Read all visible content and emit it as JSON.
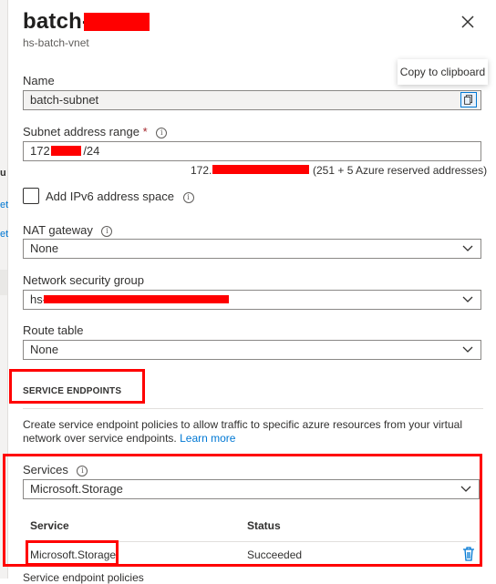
{
  "left_nav": {
    "fragments": [
      "u",
      "et",
      "et"
    ]
  },
  "panel": {
    "title_prefix": "batch-",
    "subtitle": "hs-batch-vnet",
    "copy_tooltip": "Copy to clipboard"
  },
  "fields": {
    "name": {
      "label": "Name",
      "value": "batch-subnet"
    },
    "subnet_range": {
      "label": "Subnet address range",
      "required_marker": "*",
      "value_prefix": "172.",
      "value_suffix": "/24",
      "hint_prefix": "172.",
      "hint_suffix": "(251 + 5 Azure reserved addresses)"
    },
    "ipv6": {
      "label": "Add IPv6 address space",
      "checked": false
    },
    "nat_gateway": {
      "label": "NAT gateway",
      "value": "None"
    },
    "nsg": {
      "label": "Network security group",
      "value_prefix": "hs-"
    },
    "route_table": {
      "label": "Route table",
      "value": "None"
    }
  },
  "service_endpoints": {
    "heading": "SERVICE ENDPOINTS",
    "description": "Create service endpoint policies to allow traffic to specific azure resources from your virtual network over service endpoints.",
    "learn_more": "Learn more",
    "services_label": "Services",
    "services_value": "Microsoft.Storage",
    "table": {
      "headers": [
        "Service",
        "Status"
      ],
      "rows": [
        {
          "service": "Microsoft.Storage",
          "status": "Succeeded"
        }
      ]
    },
    "next_label": "Service endpoint policies"
  },
  "colors": {
    "accent": "#0078d4",
    "annotation": "#ff0000",
    "redaction": "#ff0000",
    "text": "#323130"
  },
  "icons": [
    "close-icon",
    "copy-icon",
    "info-icon",
    "chevron-down-icon",
    "trash-icon"
  ]
}
